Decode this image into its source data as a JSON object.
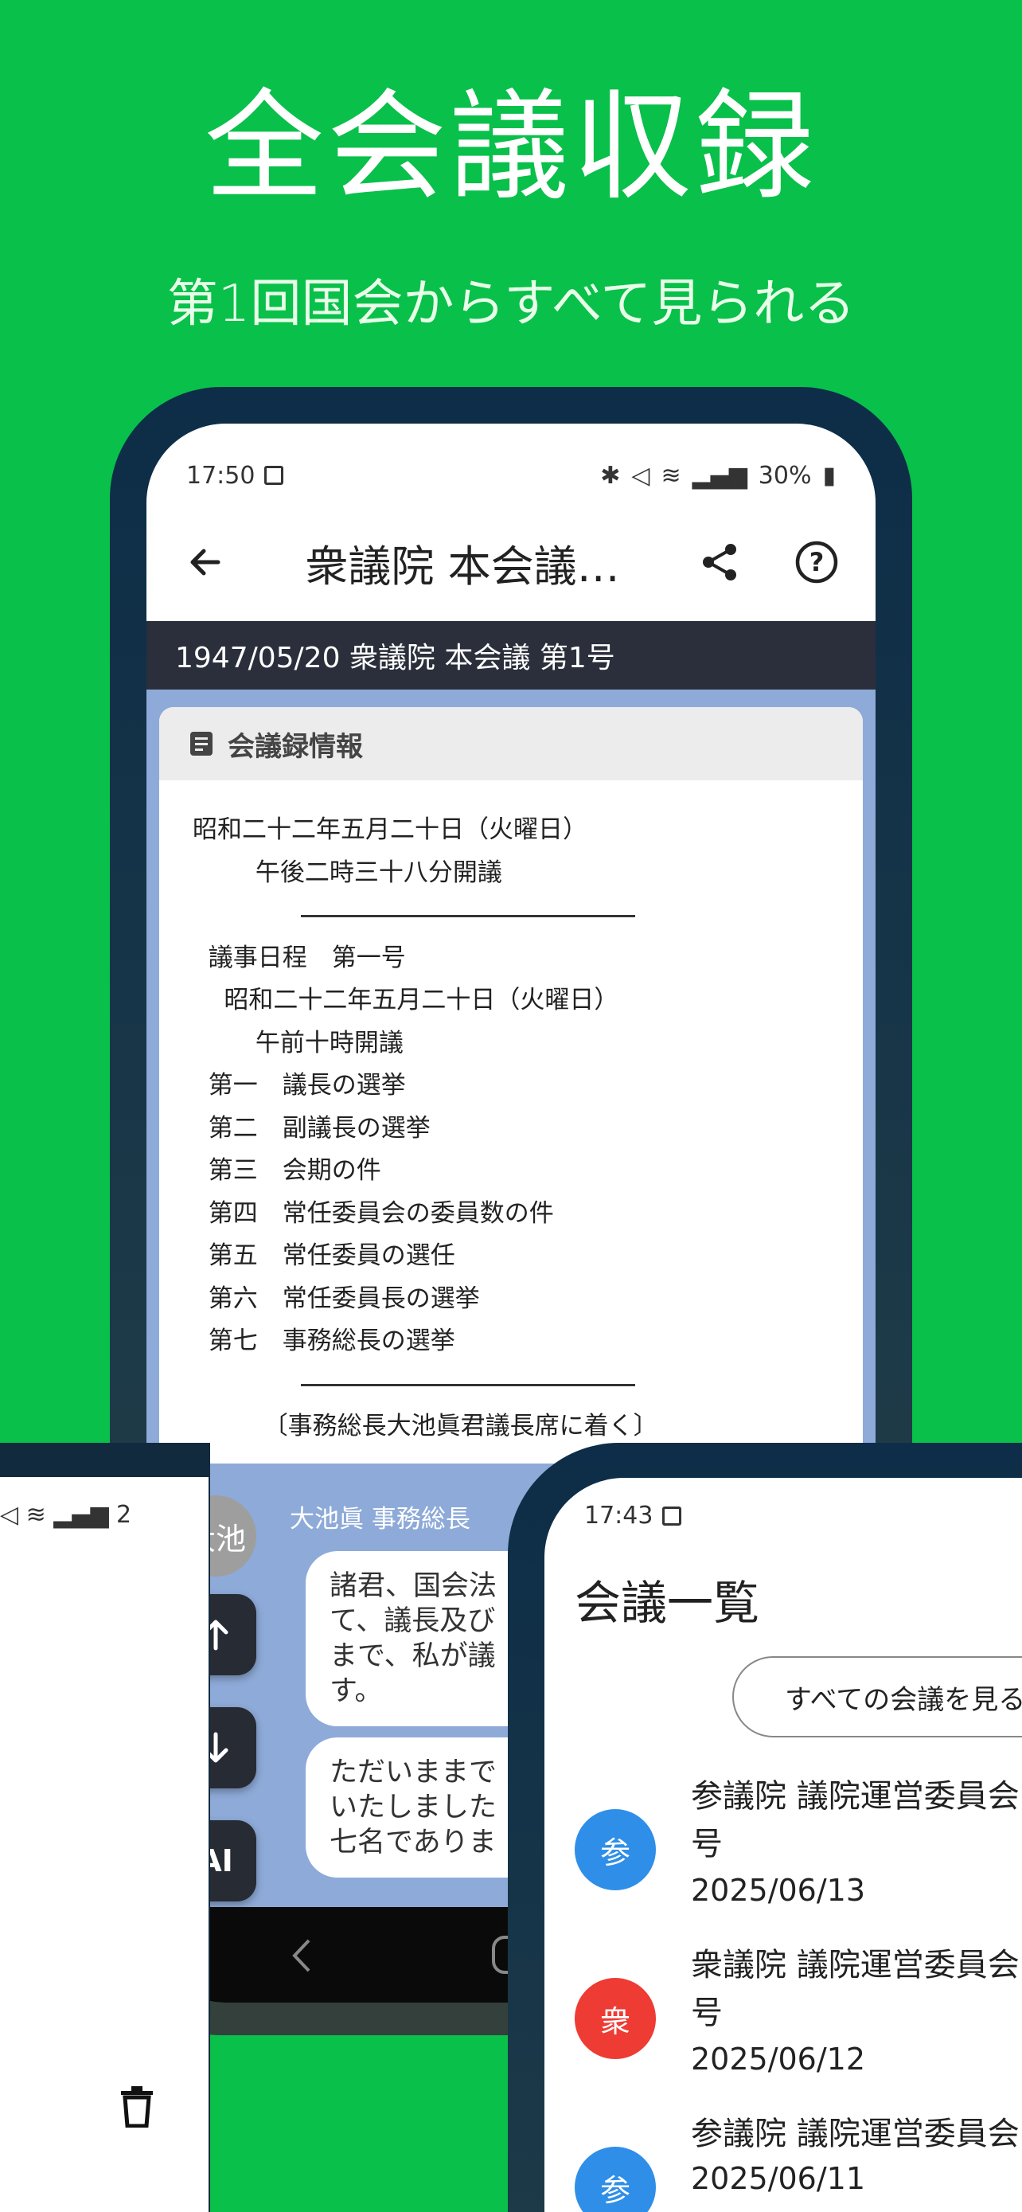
{
  "hero": {
    "title": "全会議収録",
    "subtitle": "第1回国会からすべて見られる"
  },
  "main_screen": {
    "status": {
      "time": "17:50",
      "battery": "30%"
    },
    "appbar": {
      "title": "衆議院 本会議…"
    },
    "date_bar": "1947/05/20 衆議院 本会議 第1号",
    "card_header": "会議録情報",
    "minutes_lines": [
      "昭和二十二年五月二十日（火曜日）",
      "        午後二時三十八分開議",
      "",
      "  議事日程　第一号",
      "    昭和二十二年五月二十日（火曜日）",
      "        午前十時開議",
      "  第一　議長の選挙",
      "  第二　副議長の選挙",
      "  第三　会期の件",
      "  第四　常任委員会の委員数の件",
      "  第五　常任委員の選任",
      "  第六　常任委員長の選挙",
      "  第七　事務総長の選挙",
      "",
      "         〔事務総長大池眞君議長席に着く〕"
    ],
    "speaker": "大池眞 事務総長",
    "avatar": "大池",
    "bubble1": "諸君、国会法\nて、議長及び\nまで、私が議\nす。",
    "bubble2": "ただいままで\nいたしました\n七名でありま",
    "ai_label": "AI"
  },
  "left_screen": {
    "status": "2"
  },
  "right_screen": {
    "status": {
      "time": "17:43"
    },
    "heading": "会議一覧",
    "all_button": "すべての会議を見る",
    "items": [
      {
        "house": "参",
        "color": "#2f8ee8",
        "name1": "参議院 議院運営委員会",
        "name2": "号",
        "date": "2025/06/13"
      },
      {
        "house": "衆",
        "color": "#ee3b33",
        "name1": "衆議院 議院運営委員会",
        "name2": "号",
        "date": "2025/06/12"
      },
      {
        "house": "参",
        "color": "#2f8ee8",
        "name1": "参議院 議院運営委員会",
        "name2": "",
        "date": "2025/06/11"
      }
    ]
  }
}
